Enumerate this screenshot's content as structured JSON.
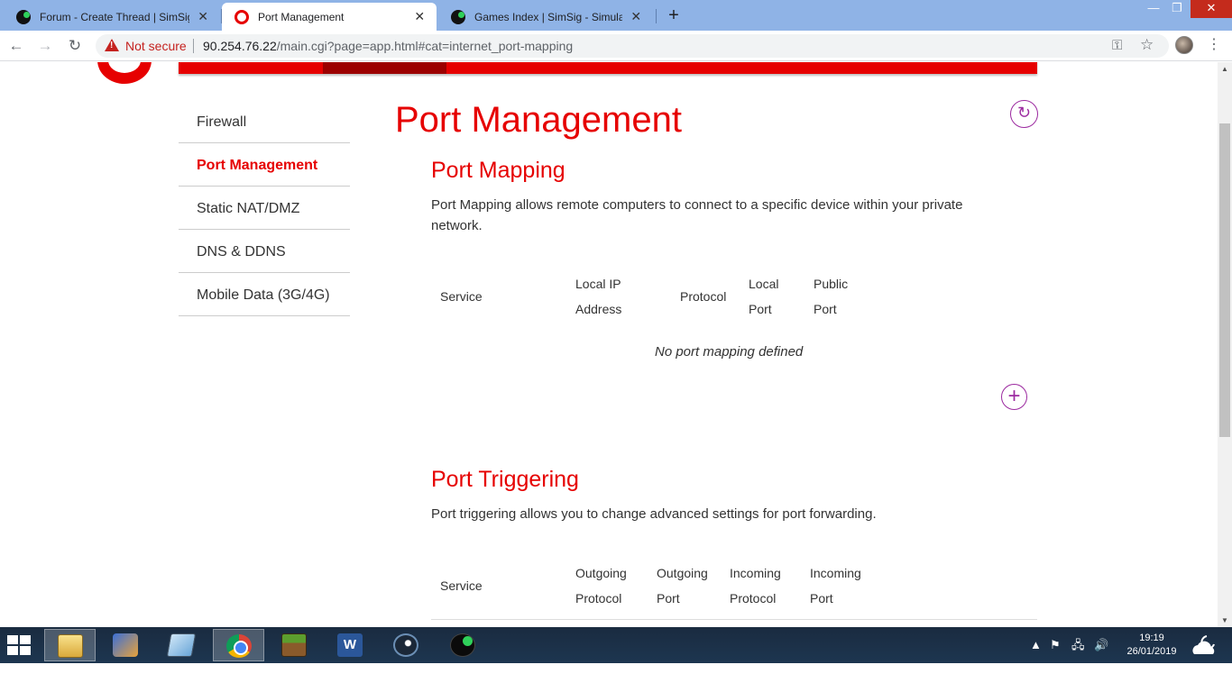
{
  "browser": {
    "tabs": [
      {
        "title": "Forum - Create Thread | SimSig - ",
        "icon": "simsig-icon"
      },
      {
        "title": "Port Management",
        "icon": "vodafone-icon"
      },
      {
        "title": "Games Index | SimSig - Simulator",
        "icon": "simsig-icon"
      }
    ],
    "new_tab": "+",
    "security_label": "Not secure",
    "url_host": "90.254.76.22",
    "url_rest": "/main.cgi?page=app.html#cat=internet_port-mapping"
  },
  "sidebar": {
    "items": [
      {
        "label": "Firewall"
      },
      {
        "label": "Port Management"
      },
      {
        "label": "Static NAT/DMZ"
      },
      {
        "label": "DNS & DDNS"
      },
      {
        "label": "Mobile Data (3G/4G)"
      }
    ],
    "current": "Port Management"
  },
  "main": {
    "title": "Port Management",
    "port_mapping": {
      "heading": "Port Mapping",
      "description": "Port Mapping allows remote computers to connect to a specific device within your private network.",
      "columns": [
        {
          "line1": "Service",
          "line2": ""
        },
        {
          "line1": "Local IP",
          "line2": "Address"
        },
        {
          "line1": "Protocol",
          "line2": ""
        },
        {
          "line1": "Local",
          "line2": "Port"
        },
        {
          "line1": "Public",
          "line2": "Port"
        }
      ],
      "empty_message": "No port mapping defined"
    },
    "port_triggering": {
      "heading": "Port Triggering",
      "description": "Port triggering allows you to change advanced settings for port forwarding.",
      "columns": [
        {
          "line1": "Service",
          "line2": ""
        },
        {
          "line1": "Outgoing",
          "line2": "Protocol"
        },
        {
          "line1": "Outgoing",
          "line2": "Port"
        },
        {
          "line1": "Incoming",
          "line2": "Protocol"
        },
        {
          "line1": "Incoming",
          "line2": "Port"
        }
      ]
    }
  },
  "taskbar": {
    "time": "19:19",
    "date": "26/01/2019",
    "apps": [
      "file-explorer",
      "app-2",
      "app-3",
      "chrome",
      "minecraft",
      "word",
      "steam",
      "simsig"
    ],
    "active_app": "chrome"
  },
  "colors": {
    "brand_red": "#e60000",
    "accent_purple": "#9c2aa0"
  }
}
